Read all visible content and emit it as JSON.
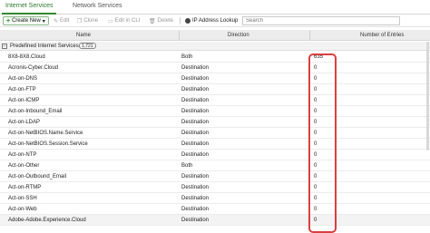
{
  "tabs": [
    {
      "label": "Internet Services",
      "active": true
    },
    {
      "label": "Network Services",
      "active": false
    }
  ],
  "toolbar": {
    "create_new": "Create New",
    "edit": "Edit",
    "clone": "Clone",
    "edit_cli": "Edit in CLI",
    "delete": "Delete",
    "ip_lookup": "IP Address Lookup",
    "search_placeholder": "Search"
  },
  "columns": {
    "name": "Name",
    "direction": "Direction",
    "entries": "Number of Entries"
  },
  "group": {
    "label": "Predefined Internet Services",
    "count": "1,721"
  },
  "rows": [
    {
      "name": "8X8-8X8.Cloud",
      "direction": "Both",
      "entries": "635"
    },
    {
      "name": "Acronis-Cyber.Cloud",
      "direction": "Destination",
      "entries": "0"
    },
    {
      "name": "Act-on-DNS",
      "direction": "Destination",
      "entries": "0"
    },
    {
      "name": "Act-on-FTP",
      "direction": "Destination",
      "entries": "0"
    },
    {
      "name": "Act-on-ICMP",
      "direction": "Destination",
      "entries": "0"
    },
    {
      "name": "Act-on-Inbound_Email",
      "direction": "Destination",
      "entries": "0"
    },
    {
      "name": "Act-on-LDAP",
      "direction": "Destination",
      "entries": "0"
    },
    {
      "name": "Act-on-NetBIOS.Name.Service",
      "direction": "Destination",
      "entries": "0"
    },
    {
      "name": "Act-on-NetBIOS.Session.Service",
      "direction": "Destination",
      "entries": "0"
    },
    {
      "name": "Act-on-NTP",
      "direction": "Destination",
      "entries": "0"
    },
    {
      "name": "Act-on-Other",
      "direction": "Both",
      "entries": "0"
    },
    {
      "name": "Act-on-Outbound_Email",
      "direction": "Destination",
      "entries": "0"
    },
    {
      "name": "Act-on-RTMP",
      "direction": "Destination",
      "entries": "0"
    },
    {
      "name": "Act-on-SSH",
      "direction": "Destination",
      "entries": "0"
    },
    {
      "name": "Act-on-Web",
      "direction": "Destination",
      "entries": "0"
    },
    {
      "name": "Adobe-Adobe.Experience.Cloud",
      "direction": "Destination",
      "entries": "0"
    }
  ],
  "colors": {
    "accent": "#2f8a2f",
    "highlight": "#d94040"
  }
}
